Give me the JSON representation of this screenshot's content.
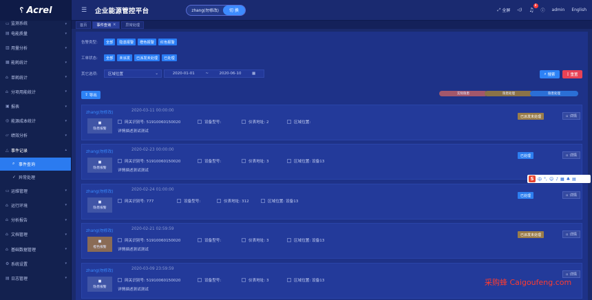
{
  "sidebar": {
    "logo": "Acrel",
    "items": [
      {
        "label": "监测系统",
        "icon": "monitor-icon"
      },
      {
        "label": "电能质量",
        "icon": "clipboard-icon"
      },
      {
        "label": "用量分析",
        "icon": "chart-icon"
      },
      {
        "label": "能耗统计",
        "icon": "stats-icon"
      },
      {
        "label": "单耗统计",
        "icon": "lock-icon"
      },
      {
        "label": "分项用能统计",
        "icon": "lock-icon"
      },
      {
        "label": "报表",
        "icon": "report-icon"
      },
      {
        "label": "能源成本统计",
        "icon": "coin-icon"
      },
      {
        "label": "绩效分析",
        "icon": "folder-icon"
      },
      {
        "label": "事件记录",
        "icon": "warning-icon"
      }
    ],
    "sub_items": [
      {
        "label": "事件查询",
        "icon": "search-icon"
      },
      {
        "label": "异常处理",
        "icon": "check-icon"
      }
    ],
    "items_after": [
      {
        "label": "运维管理",
        "icon": "tool-icon"
      },
      {
        "label": "运行环境",
        "icon": "lock-icon"
      },
      {
        "label": "分析报告",
        "icon": "lock-icon"
      },
      {
        "label": "文档管理",
        "icon": "lock-icon"
      },
      {
        "label": "基础数据管理",
        "icon": "lock-icon"
      },
      {
        "label": "系统设置",
        "icon": "gear-icon"
      },
      {
        "label": "日志管理",
        "icon": "clipboard-icon"
      }
    ]
  },
  "header": {
    "title": "企业能源管控平台",
    "company": "zhang(勿修改)",
    "switch_label": "切 换",
    "fullscreen": "全屏",
    "notification_count": "8",
    "user": "admin",
    "language": "English"
  },
  "tabs": [
    {
      "label": "首页"
    },
    {
      "label": "事件查询"
    },
    {
      "label": "异常处理"
    }
  ],
  "filters": {
    "alarm_type_label": "告警类型:",
    "alarm_types": [
      "全部",
      "隐患报警",
      "橙色报警",
      "红色报警"
    ],
    "work_status_label": "工单状态:",
    "work_statuses": [
      "全部",
      "未派发",
      "已派发未处理",
      "已处理"
    ],
    "area_label": "其它选项:",
    "area_placeholder": "区域位置",
    "date_start": "2020-01-01",
    "date_sep": "~",
    "date_end": "2020-06-10",
    "search_label": "搜索",
    "reset_label": "重置",
    "export_label": "导出"
  },
  "legend": [
    {
      "label": "实际隐患",
      "color": "#a3576b"
    },
    {
      "label": "隐患处理",
      "color": "#8a7248"
    },
    {
      "label": "隐患处理",
      "color": "#2b6fd6"
    }
  ],
  "events": [
    {
      "user": "zhang(勿修改)",
      "time": "2020-03-11 00:00:00",
      "type": "隐患报警",
      "type_style": "blue",
      "gateway": "网关识别号: 51910060150020",
      "device": "设备型号:",
      "meter": "仪表地址: 2",
      "area": "区域位置:",
      "desc": "详情描述测试测试",
      "status": "已派发未处理",
      "status_style": "pending",
      "detail": "详情"
    },
    {
      "user": "zhang(勿修改)",
      "time": "2020-02-23 00:00:00",
      "type": "隐患报警",
      "type_style": "blue",
      "gateway": "网关识别号: 51910060150020",
      "device": "设备型号:",
      "meter": "仪表地址: 3",
      "area": "区域位置: 设备13",
      "desc": "详情描述测试测试",
      "status": "已处理",
      "status_style": "done",
      "detail": "详情"
    },
    {
      "user": "zhang(勿修改)",
      "time": "2020-02-24 01:00:00",
      "type": "隐患报警",
      "type_style": "blue",
      "gateway": "网关识别号: 777",
      "device": "设备型号:",
      "meter": "仪表地址: 312",
      "area": "区域位置: 设备13",
      "desc": "",
      "status": "已处理",
      "status_style": "done",
      "detail": "详情"
    },
    {
      "user": "zhang(勿修改)",
      "time": "2020-02-21 02:59:59",
      "type": "橙色报警",
      "type_style": "orange",
      "gateway": "网关识别号: 51910060150020",
      "device": "设备型号:",
      "meter": "仪表地址: 3",
      "area": "区域位置: 设备13",
      "desc": "详情描述测试测试",
      "status": "已派发未处理",
      "status_style": "pending",
      "detail": "详情"
    },
    {
      "user": "zhang(勿修改)",
      "time": "2020-03-09 23:59:59",
      "type": "隐患报警",
      "type_style": "blue",
      "gateway": "网关识别号: 51910060150020",
      "device": "设备型号:",
      "meter": "仪表地址: 3",
      "area": "区域位置: 设备13",
      "desc": "详情描述测试测试",
      "status": "",
      "status_style": "none",
      "detail": "详情"
    }
  ],
  "ime_label": "中",
  "watermark": "采购蜂 Caigoufeng.com"
}
